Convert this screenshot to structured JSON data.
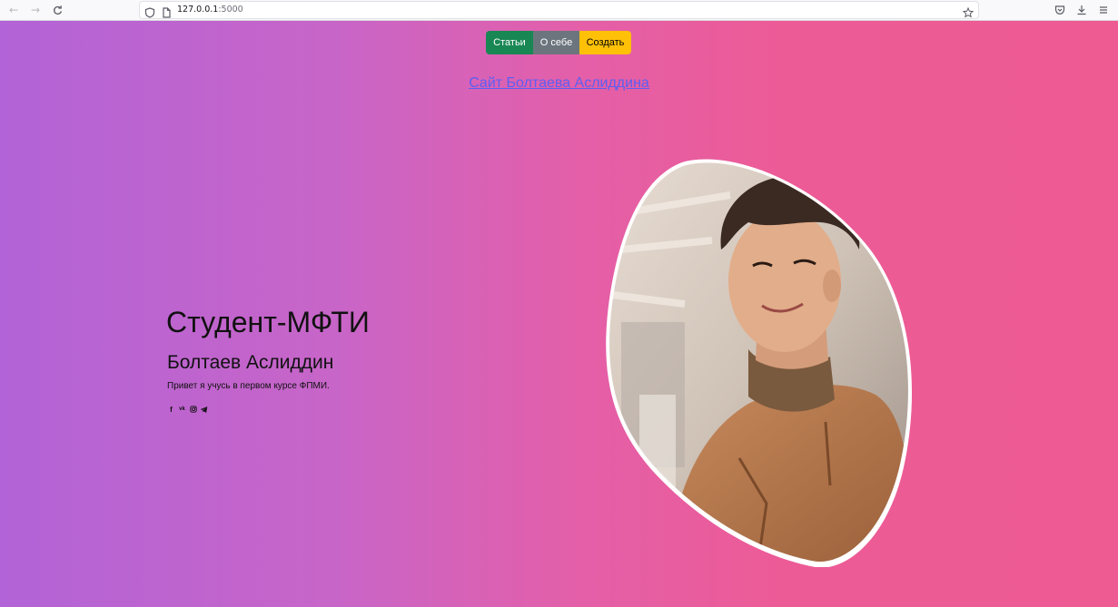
{
  "browser": {
    "url_host": "127.0.0.1",
    "url_port": ":5000",
    "icons": [
      "back-arrow-icon",
      "forward-arrow-icon",
      "reload-icon",
      "shield-icon",
      "page-icon",
      "star-icon",
      "pocket-icon",
      "download-icon",
      "menu-icon"
    ]
  },
  "nav": {
    "articles_label": "Статьи",
    "about_label": "О себе",
    "create_label": "Создать",
    "colors": {
      "articles": "#198754",
      "about": "#6c757d",
      "create": "#ffc107"
    }
  },
  "site_link": "Сайт Болтаева Аслиддина",
  "hero": {
    "title": "Студент-МФТИ",
    "name": "Болтаев Аслиддин",
    "description": "Привет я учусь в первом курсе ФПМИ.",
    "social_icons": [
      "facebook-icon",
      "vk-icon",
      "instagram-icon",
      "telegram-icon"
    ]
  },
  "theme": {
    "gradient_start": "#b263d7",
    "gradient_end": "#ee5b93",
    "link_color": "#5c5ff0"
  }
}
